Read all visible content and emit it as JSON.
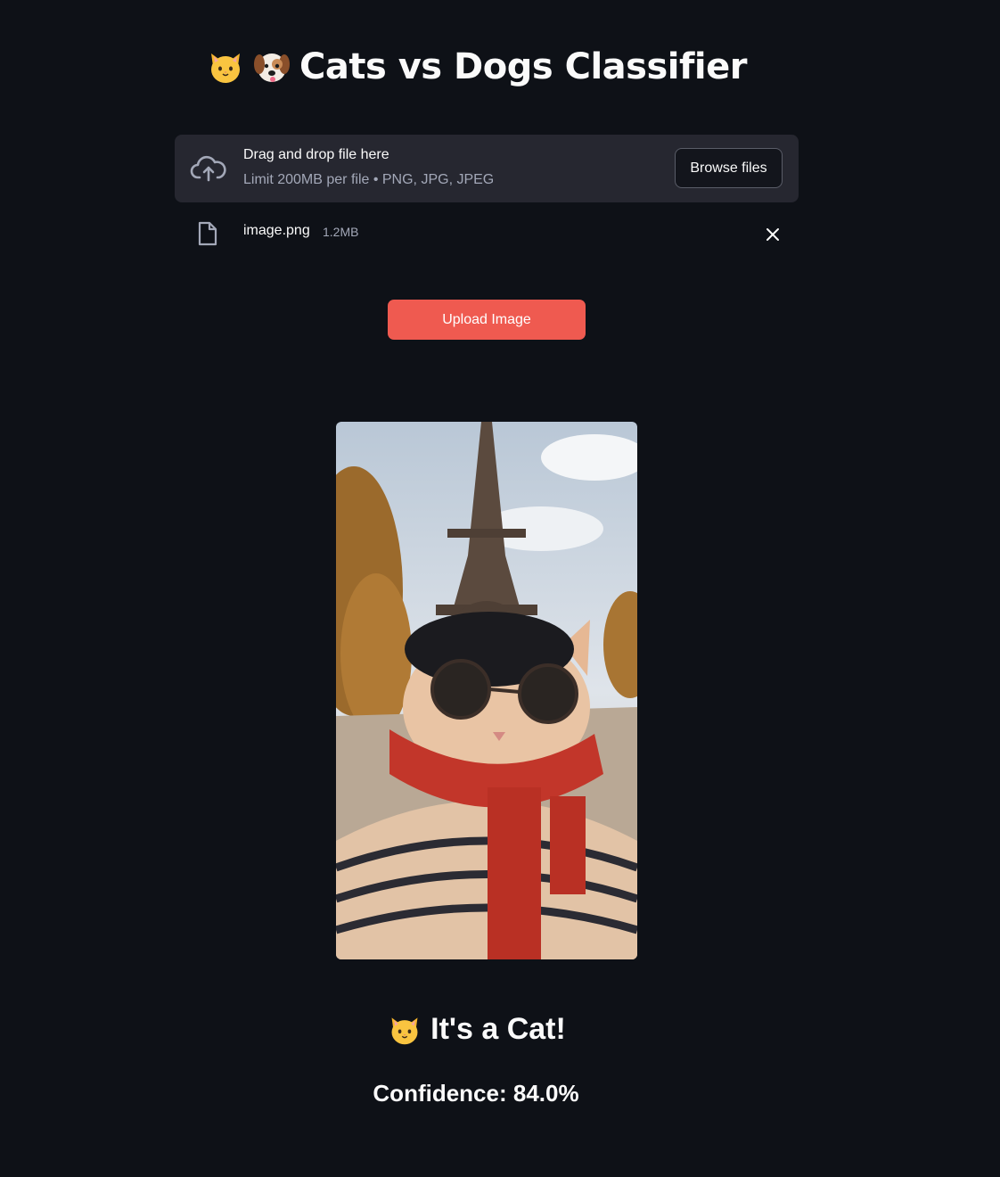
{
  "title": {
    "icons": [
      "cat-face-icon",
      "dog-face-icon"
    ],
    "text": "Cats vs Dogs Classifier"
  },
  "uploader": {
    "icon": "cloud-upload-icon",
    "drop_label": "Drag and drop file here",
    "limit_label": "Limit 200MB per file • PNG, JPG, JPEG",
    "browse_label": "Browse files"
  },
  "file": {
    "icon": "file-icon",
    "name": "image.png",
    "size": "1.2MB",
    "remove_icon": "close-icon"
  },
  "upload_button": {
    "label": "Upload Image"
  },
  "image": {
    "subject": "cat-photo"
  },
  "result": {
    "icon": "cat-face-icon",
    "text": "It's a Cat!"
  },
  "confidence": {
    "text": "Confidence: 84.0%"
  },
  "colors": {
    "background": "#0e1117",
    "panel": "#262730",
    "accent": "#ef5a50"
  }
}
